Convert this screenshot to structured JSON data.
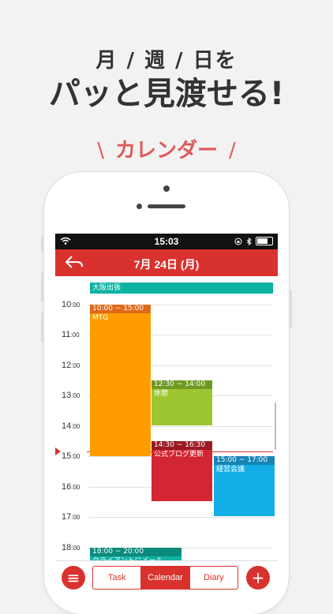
{
  "headline": {
    "line1": "月 / 週 / 日を",
    "line2": "パッと見渡せる!"
  },
  "tagline": {
    "text": "カレンダー",
    "slash_left": "\\",
    "slash_right": "/"
  },
  "status": {
    "time": "15:03"
  },
  "nav": {
    "title": "7月 24日 (月)"
  },
  "allday_event": {
    "title": "大阪出張",
    "color": "#0db3a2"
  },
  "hours": [
    {
      "h": "10",
      "m": ":00"
    },
    {
      "h": "11",
      "m": ":00"
    },
    {
      "h": "12",
      "m": ":00"
    },
    {
      "h": "13",
      "m": ":00"
    },
    {
      "h": "14",
      "m": ":00"
    },
    {
      "h": "15",
      "m": ":00"
    },
    {
      "h": "16",
      "m": ":00"
    },
    {
      "h": "17",
      "m": ":00"
    },
    {
      "h": "18",
      "m": ":00"
    }
  ],
  "events": [
    {
      "time": "10:00 ~ 15:00",
      "title": "MTG",
      "color": "#ff9d00",
      "header_color": "#e0691a"
    },
    {
      "time": "12:30 ~ 14:00",
      "title": "休憩",
      "color": "#9ec631",
      "header_color": "#6f9a22"
    },
    {
      "time": "14:30 ~ 16:30",
      "title": "公式ブログ更新",
      "color": "#d42533",
      "header_color": "#9a1a23"
    },
    {
      "time": "15:00 ~ 17:00",
      "title": "経営会議",
      "color": "#13aee6",
      "header_color": "#1784b5"
    },
    {
      "time": "18:00 ~ 20:00",
      "title": "クライアントにメール",
      "color": "#11b3a2",
      "header_color": "#0c8a7c"
    }
  ],
  "tabs": {
    "menu_icon": "≡",
    "task": "Task",
    "calendar": "Calendar",
    "diary": "Diary",
    "add_icon": "+"
  },
  "colors": {
    "accent": "#d9322e"
  }
}
